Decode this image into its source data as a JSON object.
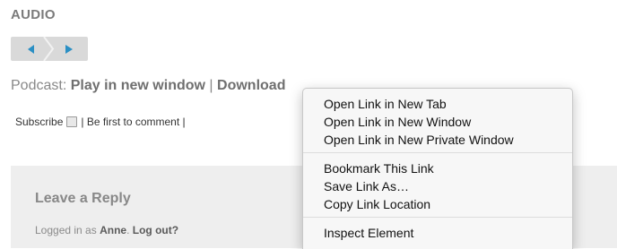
{
  "audio": {
    "title": "AUDIO"
  },
  "player": {
    "prev_icon": "speaker-left-icon",
    "play_icon": "play-icon"
  },
  "podcast": {
    "label": "Podcast:",
    "play_link": "Play in new window",
    "separator": "|",
    "download_link": "Download"
  },
  "subscribe": {
    "label": "Subscribe",
    "icon": "rss-icon",
    "text": "| Be first to comment |"
  },
  "reply": {
    "title": "Leave a Reply",
    "logged_prefix": "Logged in as",
    "user": "Anne",
    "logout": "Log out?"
  },
  "context_menu": {
    "group1": [
      "Open Link in New Tab",
      "Open Link in New Window",
      "Open Link in New Private Window"
    ],
    "group2": [
      "Bookmark This Link",
      "Save Link As…",
      "Copy Link Location"
    ],
    "group3": [
      "Inspect Element"
    ]
  },
  "colors": {
    "player_icon": "#2a8fc4",
    "panel_bg": "#eeeeee",
    "menu_bg": "#f7f7f7"
  }
}
